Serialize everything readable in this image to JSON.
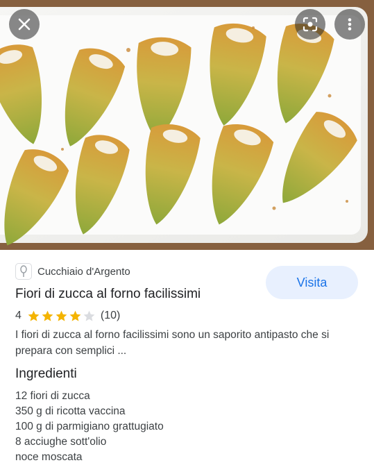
{
  "overlay": {
    "close_icon": "close-icon",
    "lens_icon": "lens-search-icon",
    "more_icon": "more-vert-icon"
  },
  "source": {
    "name": "Cucchiaio d'Argento",
    "icon": "spoon-icon"
  },
  "recipe": {
    "title": "Fiori di zucca al forno facilissimi",
    "rating_value": "4",
    "rating_stars": 4,
    "rating_max": 5,
    "review_count": "(10)",
    "description": "I fiori di zucca al forno facilissimi sono un saporito antipasto che si prepara con semplici ..."
  },
  "visit_button": {
    "label": "Visita"
  },
  "ingredients": {
    "heading": "Ingredienti",
    "items": [
      "12 fiori di zucca",
      "350 g di ricotta vaccina",
      "100 g di parmigiano grattugiato",
      "8 acciughe sott'olio",
      "noce moscata"
    ]
  },
  "colors": {
    "accent": "#1a73e8",
    "button_bg": "#e8f0fe",
    "star_filled": "#f4b400",
    "star_empty": "#dadce0"
  }
}
